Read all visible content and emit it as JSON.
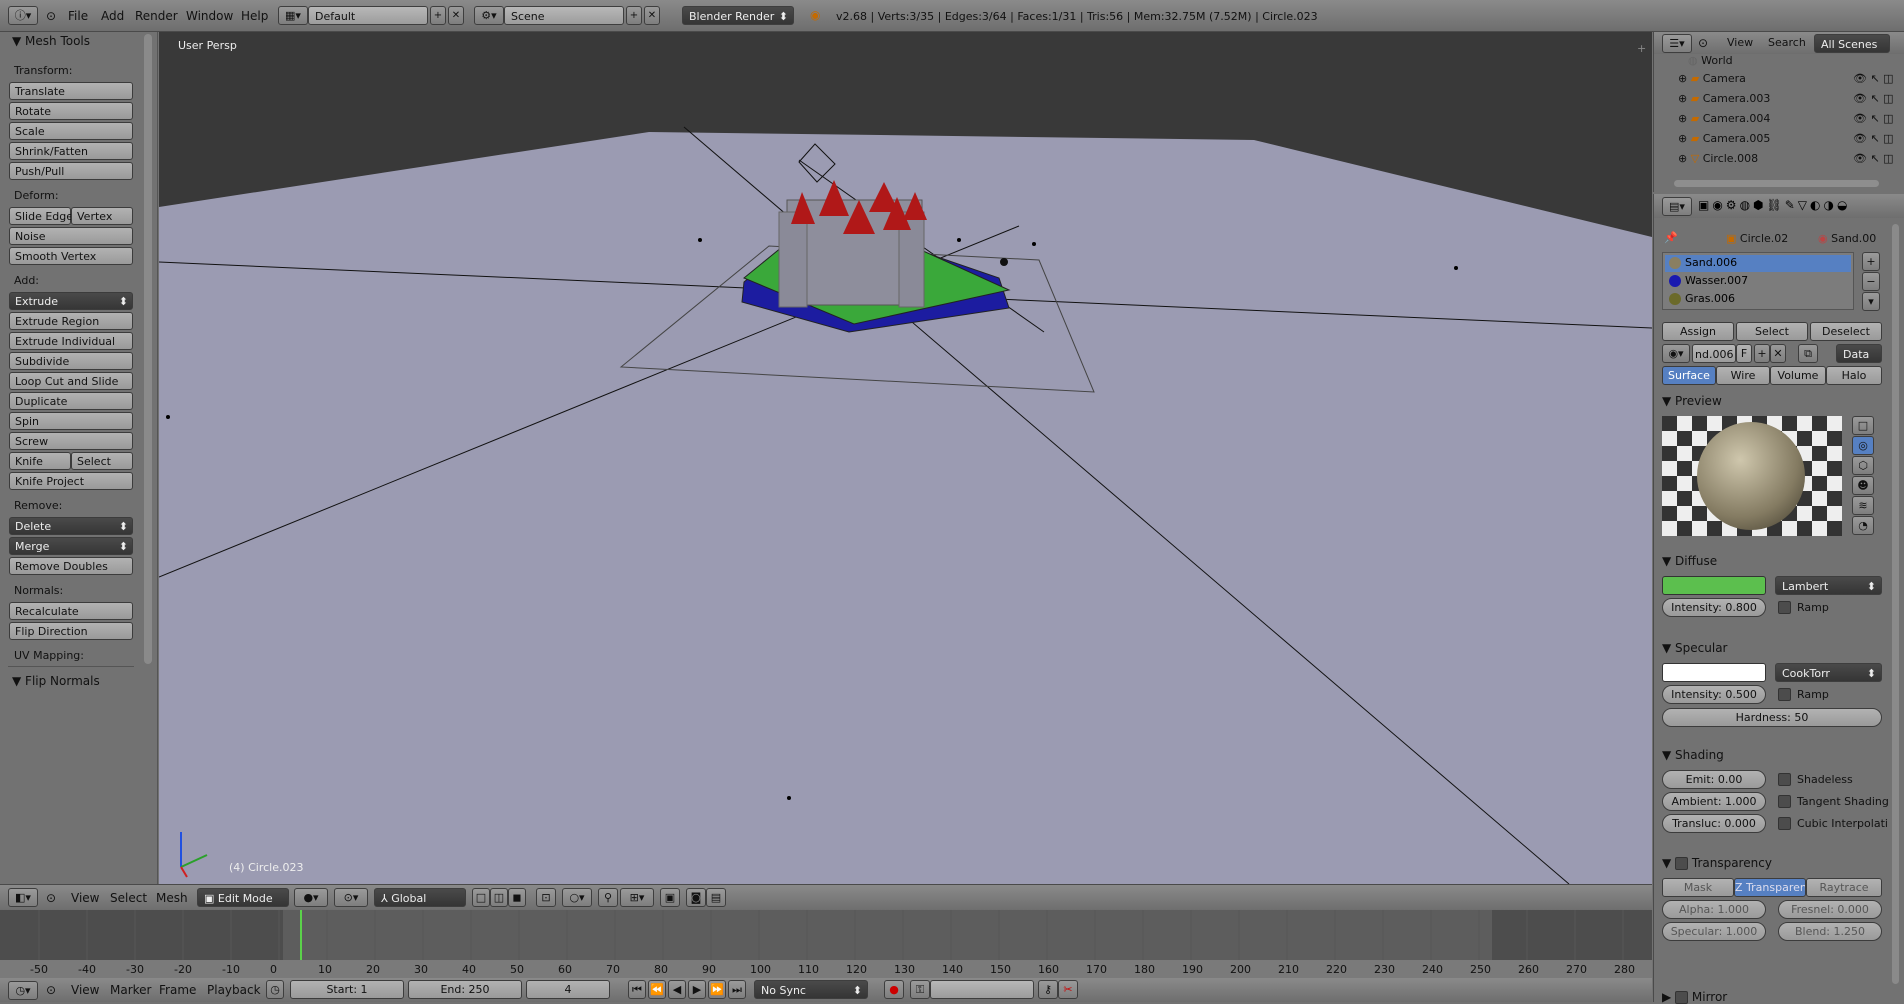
{
  "topbar": {
    "menus": [
      "File",
      "Add",
      "Render",
      "Window",
      "Help"
    ],
    "screen_layout": "Default",
    "scene": "Scene",
    "render_engine": "Blender Render",
    "stats": "v2.68 | Verts:3/35 | Edges:3/64 | Faces:1/31 | Tris:56 | Mem:32.75M (7.52M) | Circle.023"
  },
  "toolshelf": {
    "title": "Mesh Tools",
    "transform_label": "Transform:",
    "transform": [
      "Translate",
      "Rotate",
      "Scale",
      "Shrink/Fatten",
      "Push/Pull"
    ],
    "deform_label": "Deform:",
    "slide_edge": "Slide Edge",
    "vertex": "Vertex",
    "noise": "Noise",
    "smooth_vertex": "Smooth Vertex",
    "add_label": "Add:",
    "extrude": "Extrude",
    "add": [
      "Extrude Region",
      "Extrude Individual",
      "Subdivide",
      "Loop Cut and Slide",
      "Duplicate",
      "Spin",
      "Screw"
    ],
    "knife": "Knife",
    "select": "Select",
    "knife_project": "Knife Project",
    "remove_label": "Remove:",
    "delete": "Delete",
    "merge": "Merge",
    "remove_doubles": "Remove Doubles",
    "normals_label": "Normals:",
    "recalculate": "Recalculate",
    "flip_direction": "Flip Direction",
    "uv_label": "UV Mapping:",
    "flip_normals": "Flip Normals"
  },
  "viewport": {
    "view_name": "User Persp",
    "object_info": "(4) Circle.023"
  },
  "view_header": {
    "menus": [
      "View",
      "Select",
      "Mesh"
    ],
    "mode": "Edit Mode",
    "orientation": "Global"
  },
  "timeline": {
    "ticks": [
      "-50",
      "-40",
      "-30",
      "-20",
      "-10",
      "0",
      "10",
      "20",
      "30",
      "40",
      "50",
      "60",
      "70",
      "80",
      "90",
      "100",
      "110",
      "120",
      "130",
      "140",
      "150",
      "160",
      "170",
      "180",
      "190",
      "200",
      "210",
      "220",
      "230",
      "240",
      "250",
      "260",
      "270",
      "280"
    ],
    "menus": [
      "View",
      "Marker",
      "Frame",
      "Playback"
    ],
    "start": "Start: 1",
    "end": "End: 250",
    "current": "4",
    "sync": "No Sync",
    "current_frame": 4
  },
  "outliner": {
    "view": "View",
    "search": "Search",
    "scenes": "All Scenes",
    "items": [
      "World",
      "Camera",
      "Camera.003",
      "Camera.004",
      "Camera.005",
      "Circle.008"
    ]
  },
  "properties": {
    "breadcrumb_object": "Circle.02",
    "breadcrumb_material": "Sand.00",
    "materials": [
      "Sand.006",
      "Wasser.007",
      "Gras.006"
    ],
    "material_colors": [
      "#8a7f62",
      "#1a1ab0",
      "#6b6a2a"
    ],
    "assign": "Assign",
    "select": "Select",
    "deselect": "Deselect",
    "material_name": "nd.006",
    "fake_user": "F",
    "data": "Data",
    "tabs": [
      "Surface",
      "Wire",
      "Volume",
      "Halo"
    ],
    "preview": "Preview",
    "diffuse": "Diffuse",
    "diffuse_color": "#5cbf4e",
    "diffuse_shader": "Lambert",
    "diffuse_intensity": "Intensity: 0.800",
    "ramp": "Ramp",
    "specular": "Specular",
    "specular_shader": "CookTorr",
    "specular_intensity": "Intensity: 0.500",
    "hardness": "Hardness: 50",
    "shading": "Shading",
    "emit": "Emit: 0.00",
    "ambient": "Ambient: 1.000",
    "transluc": "Transluc: 0.000",
    "shadeless": "Shadeless",
    "tangent": "Tangent Shading",
    "cubic": "Cubic Interpolati",
    "transparency": "Transparency",
    "trans_tabs": [
      "Mask",
      "Z Transparenc",
      "Raytrace"
    ],
    "alpha": "Alpha: 1.000",
    "fresnel": "Fresnel: 0.000",
    "spec": "Specular: 1.000",
    "blend": "Blend: 1.250",
    "mirror": "Mirror"
  }
}
